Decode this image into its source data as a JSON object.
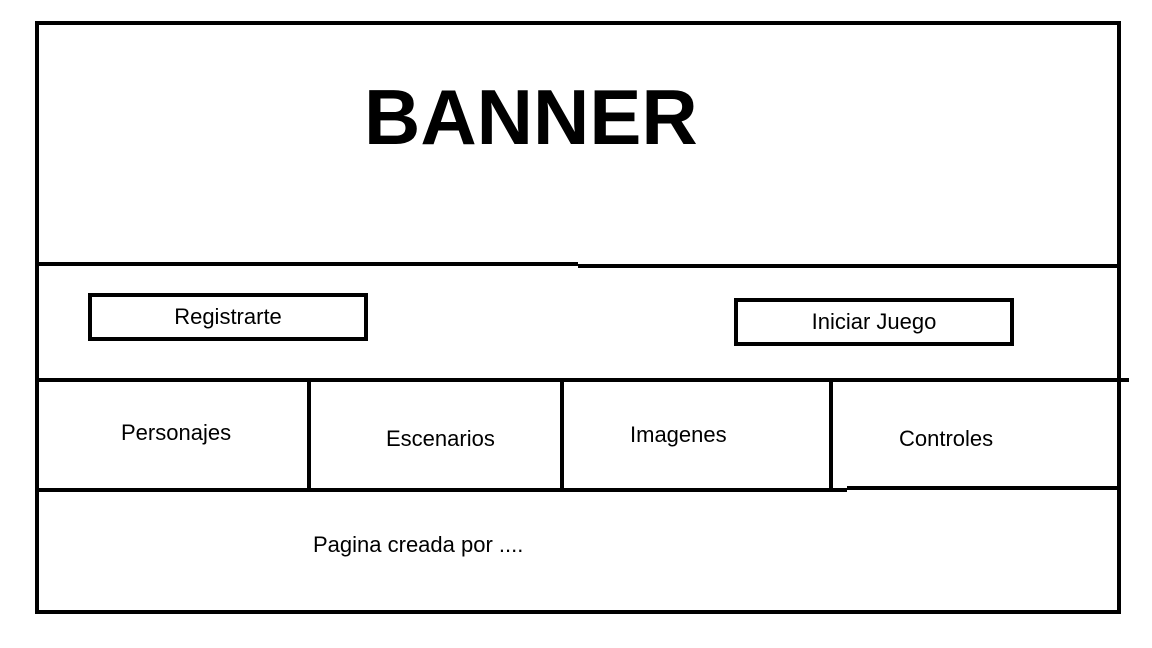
{
  "banner": {
    "title": "BANNER"
  },
  "actions": {
    "register_label": "Registrarte",
    "start_game_label": "Iniciar Juego"
  },
  "nav": {
    "items": [
      {
        "label": "Personajes"
      },
      {
        "label": "Escenarios"
      },
      {
        "label": "Imagenes"
      },
      {
        "label": "Controles"
      }
    ]
  },
  "footer": {
    "text": "Pagina creada por ...."
  }
}
